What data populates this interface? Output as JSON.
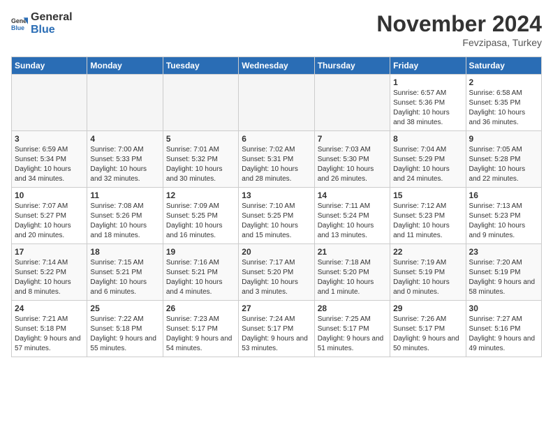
{
  "logo": {
    "text_general": "General",
    "text_blue": "Blue"
  },
  "title": "November 2024",
  "location": "Fevzipasa, Turkey",
  "days_of_week": [
    "Sunday",
    "Monday",
    "Tuesday",
    "Wednesday",
    "Thursday",
    "Friday",
    "Saturday"
  ],
  "weeks": [
    [
      {
        "day": "",
        "empty": true
      },
      {
        "day": "",
        "empty": true
      },
      {
        "day": "",
        "empty": true
      },
      {
        "day": "",
        "empty": true
      },
      {
        "day": "",
        "empty": true
      },
      {
        "day": "1",
        "sunrise": "6:57 AM",
        "sunset": "5:36 PM",
        "daylight": "10 hours and 38 minutes."
      },
      {
        "day": "2",
        "sunrise": "6:58 AM",
        "sunset": "5:35 PM",
        "daylight": "10 hours and 36 minutes."
      }
    ],
    [
      {
        "day": "3",
        "sunrise": "6:59 AM",
        "sunset": "5:34 PM",
        "daylight": "10 hours and 34 minutes."
      },
      {
        "day": "4",
        "sunrise": "7:00 AM",
        "sunset": "5:33 PM",
        "daylight": "10 hours and 32 minutes."
      },
      {
        "day": "5",
        "sunrise": "7:01 AM",
        "sunset": "5:32 PM",
        "daylight": "10 hours and 30 minutes."
      },
      {
        "day": "6",
        "sunrise": "7:02 AM",
        "sunset": "5:31 PM",
        "daylight": "10 hours and 28 minutes."
      },
      {
        "day": "7",
        "sunrise": "7:03 AM",
        "sunset": "5:30 PM",
        "daylight": "10 hours and 26 minutes."
      },
      {
        "day": "8",
        "sunrise": "7:04 AM",
        "sunset": "5:29 PM",
        "daylight": "10 hours and 24 minutes."
      },
      {
        "day": "9",
        "sunrise": "7:05 AM",
        "sunset": "5:28 PM",
        "daylight": "10 hours and 22 minutes."
      }
    ],
    [
      {
        "day": "10",
        "sunrise": "7:07 AM",
        "sunset": "5:27 PM",
        "daylight": "10 hours and 20 minutes."
      },
      {
        "day": "11",
        "sunrise": "7:08 AM",
        "sunset": "5:26 PM",
        "daylight": "10 hours and 18 minutes."
      },
      {
        "day": "12",
        "sunrise": "7:09 AM",
        "sunset": "5:25 PM",
        "daylight": "10 hours and 16 minutes."
      },
      {
        "day": "13",
        "sunrise": "7:10 AM",
        "sunset": "5:25 PM",
        "daylight": "10 hours and 15 minutes."
      },
      {
        "day": "14",
        "sunrise": "7:11 AM",
        "sunset": "5:24 PM",
        "daylight": "10 hours and 13 minutes."
      },
      {
        "day": "15",
        "sunrise": "7:12 AM",
        "sunset": "5:23 PM",
        "daylight": "10 hours and 11 minutes."
      },
      {
        "day": "16",
        "sunrise": "7:13 AM",
        "sunset": "5:23 PM",
        "daylight": "10 hours and 9 minutes."
      }
    ],
    [
      {
        "day": "17",
        "sunrise": "7:14 AM",
        "sunset": "5:22 PM",
        "daylight": "10 hours and 8 minutes."
      },
      {
        "day": "18",
        "sunrise": "7:15 AM",
        "sunset": "5:21 PM",
        "daylight": "10 hours and 6 minutes."
      },
      {
        "day": "19",
        "sunrise": "7:16 AM",
        "sunset": "5:21 PM",
        "daylight": "10 hours and 4 minutes."
      },
      {
        "day": "20",
        "sunrise": "7:17 AM",
        "sunset": "5:20 PM",
        "daylight": "10 hours and 3 minutes."
      },
      {
        "day": "21",
        "sunrise": "7:18 AM",
        "sunset": "5:20 PM",
        "daylight": "10 hours and 1 minute."
      },
      {
        "day": "22",
        "sunrise": "7:19 AM",
        "sunset": "5:19 PM",
        "daylight": "10 hours and 0 minutes."
      },
      {
        "day": "23",
        "sunrise": "7:20 AM",
        "sunset": "5:19 PM",
        "daylight": "9 hours and 58 minutes."
      }
    ],
    [
      {
        "day": "24",
        "sunrise": "7:21 AM",
        "sunset": "5:18 PM",
        "daylight": "9 hours and 57 minutes."
      },
      {
        "day": "25",
        "sunrise": "7:22 AM",
        "sunset": "5:18 PM",
        "daylight": "9 hours and 55 minutes."
      },
      {
        "day": "26",
        "sunrise": "7:23 AM",
        "sunset": "5:17 PM",
        "daylight": "9 hours and 54 minutes."
      },
      {
        "day": "27",
        "sunrise": "7:24 AM",
        "sunset": "5:17 PM",
        "daylight": "9 hours and 53 minutes."
      },
      {
        "day": "28",
        "sunrise": "7:25 AM",
        "sunset": "5:17 PM",
        "daylight": "9 hours and 51 minutes."
      },
      {
        "day": "29",
        "sunrise": "7:26 AM",
        "sunset": "5:17 PM",
        "daylight": "9 hours and 50 minutes."
      },
      {
        "day": "30",
        "sunrise": "7:27 AM",
        "sunset": "5:16 PM",
        "daylight": "9 hours and 49 minutes."
      }
    ]
  ]
}
